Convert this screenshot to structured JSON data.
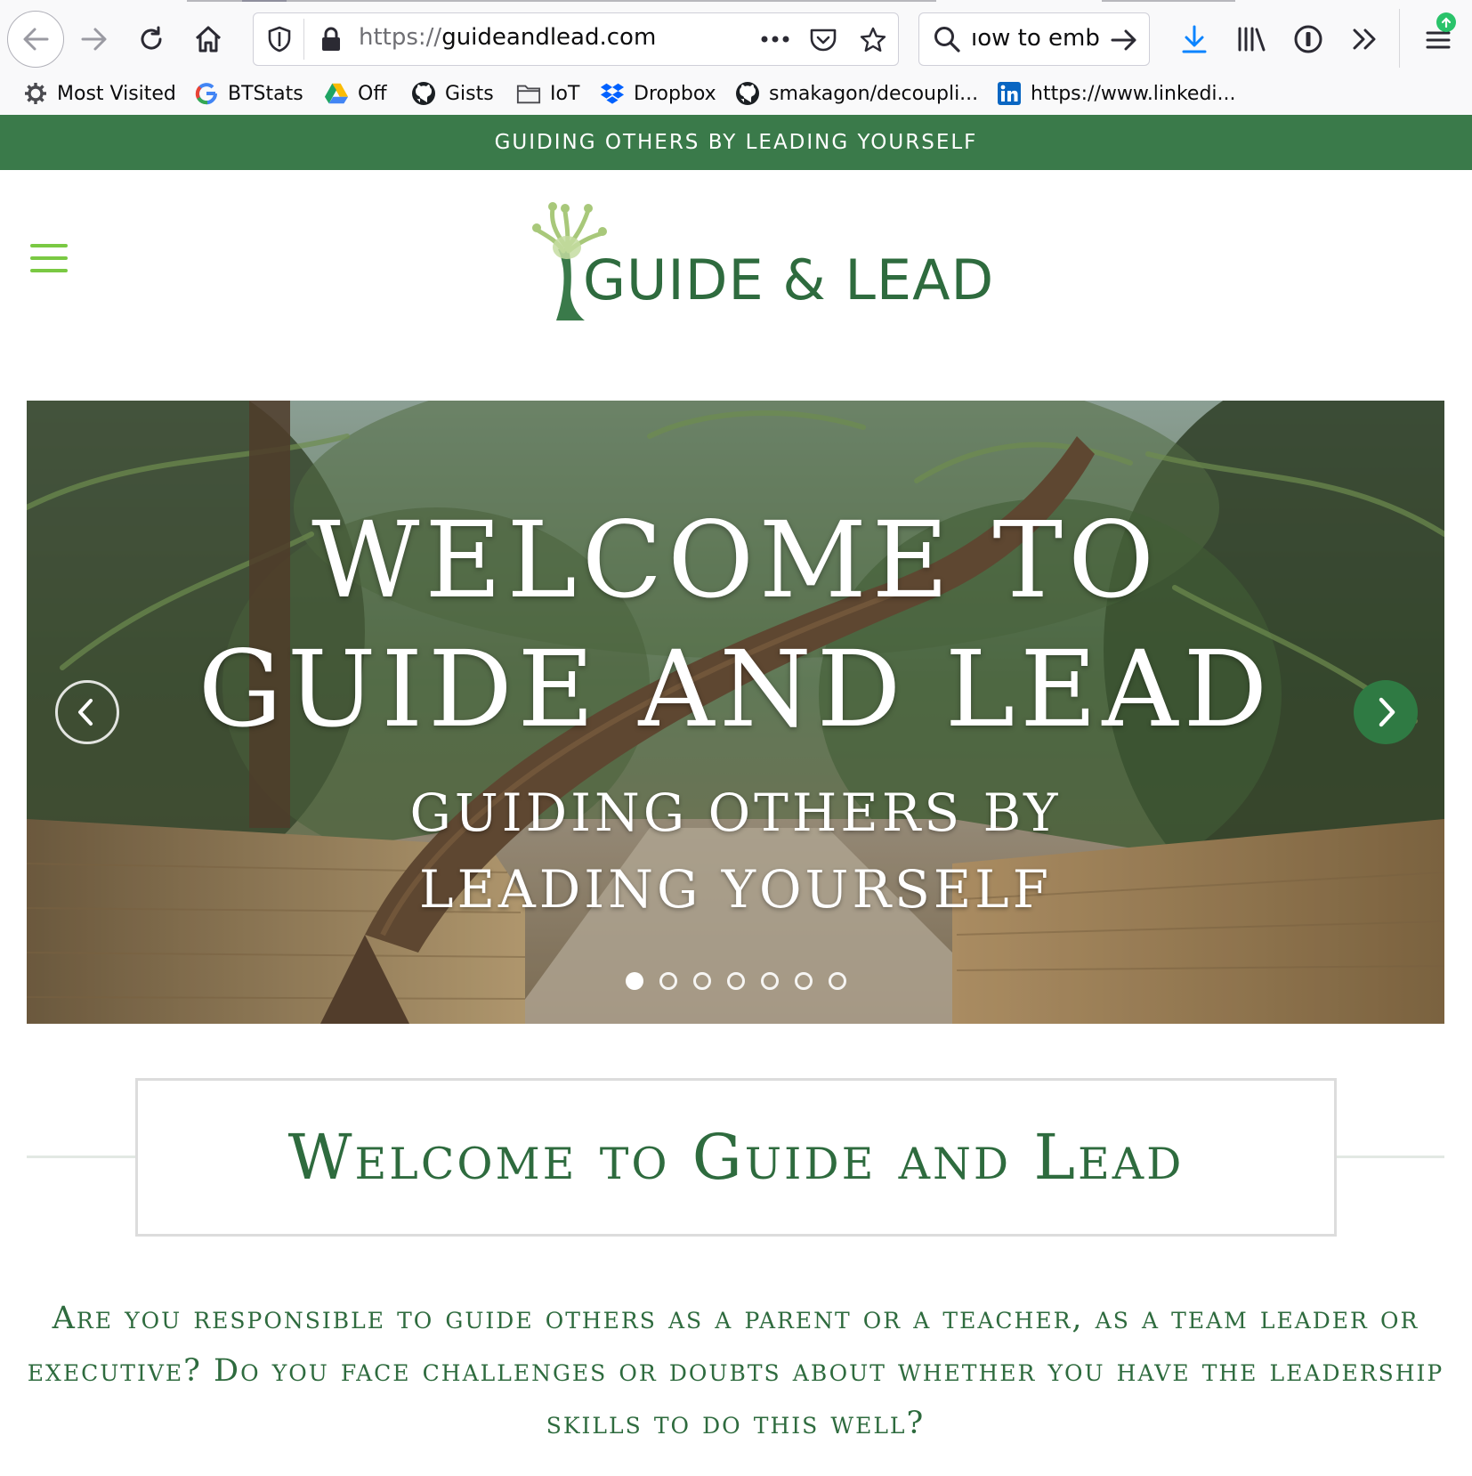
{
  "browser": {
    "url_scheme": "https://",
    "url_host": "guideandlead.com",
    "search_text": "ıow to embe",
    "bookmarks": [
      {
        "label": "Most Visited",
        "icon": "gear-icon"
      },
      {
        "label": "BTStats",
        "icon": "google-icon"
      },
      {
        "label": "Off",
        "icon": "drive-icon"
      },
      {
        "label": "Gists",
        "icon": "github-icon"
      },
      {
        "label": "IoT",
        "icon": "folder-icon"
      },
      {
        "label": "Dropbox",
        "icon": "dropbox-icon"
      },
      {
        "label": "smakagon/decoupli...",
        "icon": "github-icon"
      },
      {
        "label": "https://www.linkedi...",
        "icon": "linkedin-icon"
      }
    ]
  },
  "site": {
    "tagline_bar": "GUIDING OTHERS BY LEADING YOURSELF",
    "logo_text": "GUIDE & LEAD",
    "hero": {
      "title_line1": "WELCOME TO",
      "title_line2": "GUIDE AND LEAD",
      "subtitle": "GUIDING OTHERS BY LEADING YOURSELF",
      "slide_count": 7,
      "active_slide": 1
    },
    "welcome_heading": "Welcome to Guide and Lead",
    "intro_text": "Are you responsible to guide others as a parent or a teacher, as a team leader or executive? Do you face challenges or doubts about whether you have the leadership skills to do this well?"
  },
  "colors": {
    "brand_green": "#3a7a4a",
    "accent_light_green": "#7ac943",
    "heading_green": "#2e6b3e"
  }
}
